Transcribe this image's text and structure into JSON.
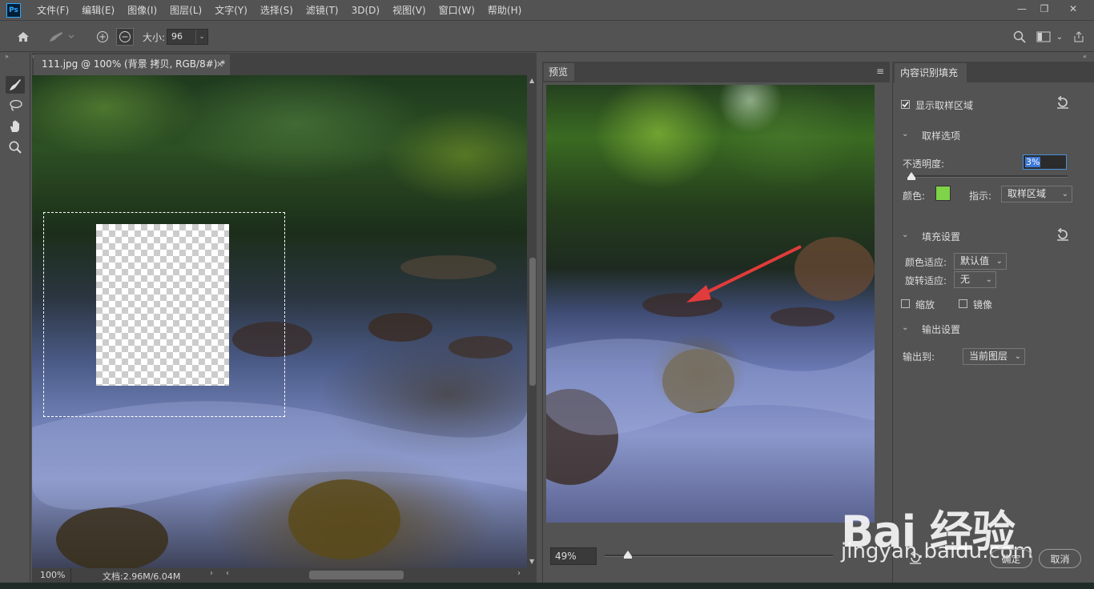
{
  "menubar": {
    "logo": "Ps",
    "items": [
      "文件(F)",
      "编辑(E)",
      "图像(I)",
      "图层(L)",
      "文字(Y)",
      "选择(S)",
      "滤镜(T)",
      "3D(D)",
      "视图(V)",
      "窗口(W)",
      "帮助(H)"
    ],
    "window_buttons": [
      "minimize",
      "restore",
      "close"
    ]
  },
  "options": {
    "size_label": "大小:",
    "size_value": "96"
  },
  "tools": [
    "sampling-brush-tool",
    "lasso-tool",
    "hand-tool",
    "zoom-tool"
  ],
  "document": {
    "tab_title": "111.jpg @ 100% (背景 拷贝, RGB/8#) *",
    "zoom": "100%",
    "doc_info": "文档:2.96M/6.04M"
  },
  "preview": {
    "tab": "预览",
    "zoom_value": "49%",
    "zoom_slider_fraction": 0.09
  },
  "panel": {
    "tab": "内容识别填充",
    "show_sampling_label": "显示取样区域",
    "show_sampling_checked": true,
    "sampling_section": "取样选项",
    "opacity_label": "不透明度:",
    "opacity_value": "3%",
    "color_label": "颜色:",
    "color_value": "#7ed348",
    "indicate_label": "指示:",
    "indicate_value": "取样区域",
    "fill_section": "填充设置",
    "color_adapt_label": "颜色适应:",
    "color_adapt_value": "默认值",
    "rotate_adapt_label": "旋转适应:",
    "rotate_adapt_value": "无",
    "scale_label": "缩放",
    "mirror_label": "镜像",
    "output_section": "输出设置",
    "output_label": "输出到:",
    "output_value": "当前图层",
    "confirm": "确定",
    "cancel": "取消"
  },
  "watermark": {
    "logo": "Bai 经验",
    "url": "jingyan.baidu.com"
  },
  "colors": {
    "ui_bg": "#535353",
    "panel_dark": "#424242",
    "accent": "#31a8ff",
    "arrow": "#e23b3b"
  }
}
